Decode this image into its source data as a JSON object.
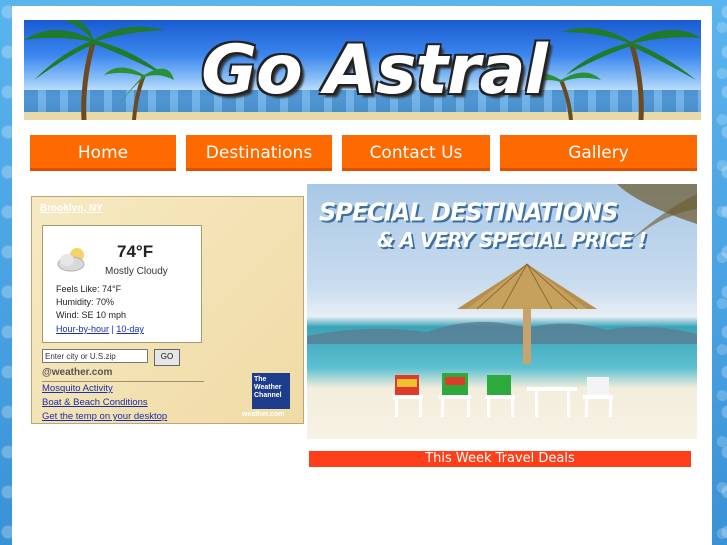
{
  "site": {
    "logo_text": "Go Astral"
  },
  "nav": {
    "items": [
      {
        "label": "Home"
      },
      {
        "label": "Destinations"
      },
      {
        "label": "Contact Us"
      },
      {
        "label": "Gallery"
      }
    ],
    "color": "#ff6a00"
  },
  "weather": {
    "city": "Brooklyn, NY",
    "temperature": "74°F",
    "condition": "Mostly Cloudy",
    "feels_like": "Feels Like: 74°F",
    "humidity": "Humidity: 70%",
    "wind": "Wind: SE 10 mph",
    "link_hourly": "Hour-by-hour",
    "link_separator": "|",
    "link_10day": "10-day",
    "search_placeholder": "Enter city or U.S.zip",
    "go_label": "GO",
    "brand": "@weather.com",
    "links": [
      {
        "label": "Mosquito Activity"
      },
      {
        "label": "Boat & Beach Conditions"
      },
      {
        "label": "Get the temp on your desktop"
      }
    ],
    "channel_logo": "The Weather Channel",
    "channel_url": "weather.com"
  },
  "promo": {
    "headline_line1": "SPECIAL DESTINATIONS",
    "headline_line2": "& A VERY SPECIAL PRICE !"
  },
  "deals": {
    "label": "This Week Travel Deals",
    "color": "#ff3f1a"
  }
}
